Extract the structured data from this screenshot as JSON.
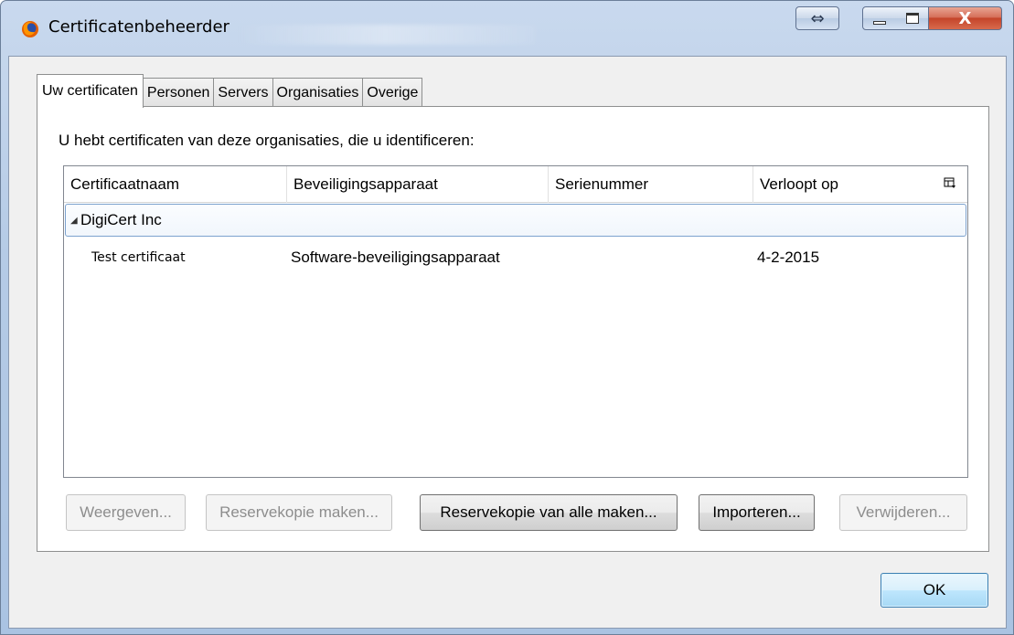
{
  "window": {
    "title": "Certificatenbeheerder",
    "resize_glyph": "⇔",
    "close_glyph": "X"
  },
  "tabs": [
    {
      "label": "Uw certificaten",
      "active": true
    },
    {
      "label": "Personen",
      "active": false
    },
    {
      "label": "Servers",
      "active": false
    },
    {
      "label": "Organisaties",
      "active": false
    },
    {
      "label": "Overige",
      "active": false
    }
  ],
  "panel": {
    "intro": "U hebt certificaten van deze organisaties, die u identificeren:"
  },
  "tree": {
    "columns": [
      "Certificaatnaam",
      "Beveiligingsapparaat",
      "Serienummer",
      "Verloopt op"
    ],
    "column_picker_icon": "column-picker-icon",
    "groups": [
      {
        "label": "DigiCert Inc",
        "expanded": true,
        "children": [
          {
            "name": "Test certificaat",
            "device": "Software-beveiligingsapparaat",
            "serial": "",
            "expires": "4-2-2015"
          }
        ]
      }
    ]
  },
  "buttons": {
    "view": "Weergeven...",
    "backup": "Reservekopie maken...",
    "backup_all": "Reservekopie van alle maken...",
    "import": "Importeren...",
    "delete": "Verwijderen...",
    "ok": "OK"
  },
  "colors": {
    "titlebar": "#b5cbe6",
    "close_button": "#c4442a",
    "selection_border": "#7da2ce",
    "ok_button": "#bee6fd"
  }
}
